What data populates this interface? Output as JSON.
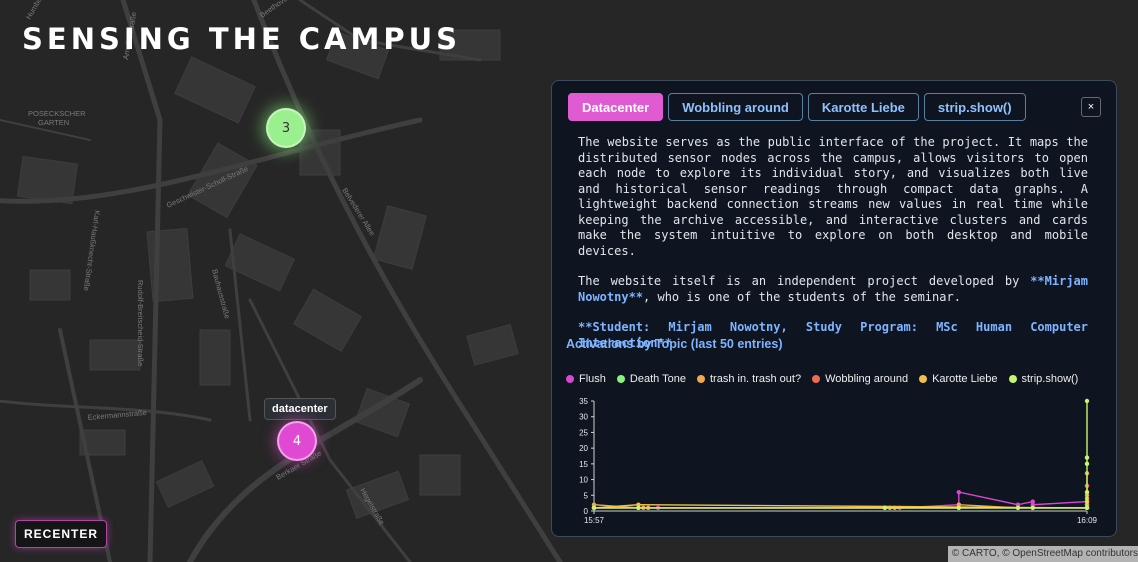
{
  "app": {
    "title": "SENSING THE CAMPUS"
  },
  "map": {
    "street_labels": [
      "Humboldtstraße",
      "Beethovenplatz",
      "Amalienstraße",
      "POSECKSCHER",
      "GARTEN",
      "Geschwister-Scholl-Straße",
      "Belvederer Allee",
      "Bauhausstraße",
      "Karl-Haußknecht-Straße",
      "Rudolf-Breitscheid-Straße",
      "Eckermannstraße",
      "Berkaer Straße",
      "Hegelstraße"
    ],
    "clusters": [
      {
        "count": "3",
        "color": "#9af08e"
      },
      {
        "count": "4",
        "color": "#e04ad2"
      }
    ],
    "tooltip": "datacenter",
    "recenter_label": "RECENTER",
    "attribution": {
      "prefix": "© ",
      "carto": "CARTO",
      "sep": ", © ",
      "osm": "OpenStreetMap",
      "suffix": " contributors"
    }
  },
  "panel": {
    "tabs": [
      {
        "label": "Datacenter",
        "active": true
      },
      {
        "label": "Wobbling around",
        "active": false
      },
      {
        "label": "Karotte Liebe",
        "active": false
      },
      {
        "label": "strip.show()",
        "active": false
      }
    ],
    "close_label": "×",
    "paragraph1": "The website serves as the public interface of the project. It maps the distributed sensor nodes across the campus, allows visitors to open each node to explore its individual story, and visualizes both live and historical sensor readings through compact data graphs. A lightweight backend connection streams new values in real time while keeping the archive accessible, and interactive clusters and cards make the system intuitive to explore on both desktop and mobile devices.",
    "paragraph2_before": "The website itself is an independent project developed by ",
    "paragraph2_highlight": "**Mirjam Nowotny**",
    "paragraph2_after": ", who is one of the students of the seminar.",
    "paragraph3": "**Student: Mirjam Nowotny, Study Program: MSc Human Computer Interaction**",
    "chart_title": "Activations by Topic (last 50 entries)"
  },
  "chart_data": {
    "type": "line",
    "title": "Activations by Topic (last 50 entries)",
    "xlabel": "",
    "ylabel": "",
    "x_ticks": [
      "15:57",
      "16:09"
    ],
    "xlim": [
      0,
      100
    ],
    "ylim": [
      0,
      35
    ],
    "y_ticks": [
      0,
      5,
      10,
      15,
      20,
      25,
      30,
      35
    ],
    "legend_position": "top",
    "grid": false,
    "series": [
      {
        "name": "Flush",
        "color": "#d946d0",
        "points": [
          [
            0,
            1
          ],
          [
            9,
            1
          ],
          [
            13,
            1
          ],
          [
            59,
            1
          ],
          [
            62,
            1
          ],
          [
            74,
            2
          ],
          [
            74,
            6
          ],
          [
            86,
            2
          ],
          [
            89,
            3
          ],
          [
            89,
            2
          ],
          [
            100,
            3
          ],
          [
            100,
            1
          ]
        ]
      },
      {
        "name": "Death Tone",
        "color": "#8df07c",
        "points": [
          [
            0,
            1
          ],
          [
            100,
            1
          ],
          [
            100,
            2
          ]
        ]
      },
      {
        "name": "trash in. trash out?",
        "color": "#f0a848",
        "points": [
          [
            0,
            2
          ],
          [
            9,
            1
          ],
          [
            10,
            1
          ],
          [
            11,
            1
          ],
          [
            59,
            1
          ],
          [
            60,
            1
          ],
          [
            61,
            1
          ],
          [
            74,
            1
          ],
          [
            74,
            2
          ],
          [
            86,
            1
          ],
          [
            89,
            1
          ],
          [
            100,
            1
          ],
          [
            100,
            2
          ],
          [
            100,
            3
          ],
          [
            100,
            5
          ],
          [
            100,
            8
          ],
          [
            100,
            12
          ]
        ]
      },
      {
        "name": "Wobbling around",
        "color": "#ef6a52",
        "points": [
          [
            0,
            1
          ],
          [
            100,
            1
          ],
          [
            100,
            8
          ]
        ]
      },
      {
        "name": "Karotte Liebe",
        "color": "#f2c045",
        "points": [
          [
            0,
            1
          ],
          [
            9,
            2
          ],
          [
            100,
            1
          ],
          [
            100,
            3
          ],
          [
            100,
            4
          ]
        ]
      },
      {
        "name": "strip.show()",
        "color": "#c8f56a",
        "points": [
          [
            0,
            1
          ],
          [
            9,
            1
          ],
          [
            59,
            1
          ],
          [
            74,
            1
          ],
          [
            86,
            1
          ],
          [
            89,
            1
          ],
          [
            100,
            1
          ],
          [
            100,
            6
          ],
          [
            100,
            15
          ],
          [
            100,
            17
          ],
          [
            100,
            35
          ]
        ]
      }
    ]
  }
}
